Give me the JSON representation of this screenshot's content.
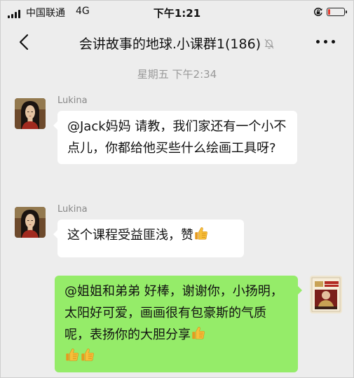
{
  "status_bar": {
    "carrier": "中国联通",
    "network": "4G",
    "time": "下午1:21",
    "battery_level": 0.15,
    "battery_color": "#e43b2d"
  },
  "nav": {
    "title": "会讲故事的地球.小课群1(186)",
    "back_icon": "chevron-left-icon",
    "mute_icon": "bell-muted-icon",
    "more_icon": "ellipsis-icon"
  },
  "chat": {
    "timestamp": "星期五 下午2:34",
    "messages": [
      {
        "sender": "Lukina",
        "text": "@Jack妈妈 请教，我们家还有一个小不点儿，你都给他买些什么绘画工具呀?"
      },
      {
        "sender": "Lukina",
        "text": "这个课程受益匪浅，赞",
        "emoji": "thumbs-up-icon"
      },
      {
        "sender": "",
        "text": "@姐姐和弟弟 好棒，谢谢你，小扬明，太阳好可爱，画画很有包豪斯的气质呢，表扬你的大胆分享",
        "emoji": "thumbs-up-icon",
        "emoji_count": 3
      }
    ]
  },
  "colors": {
    "background": "#ededed",
    "incoming_bubble": "#ffffff",
    "outgoing_bubble": "#95ec69"
  }
}
